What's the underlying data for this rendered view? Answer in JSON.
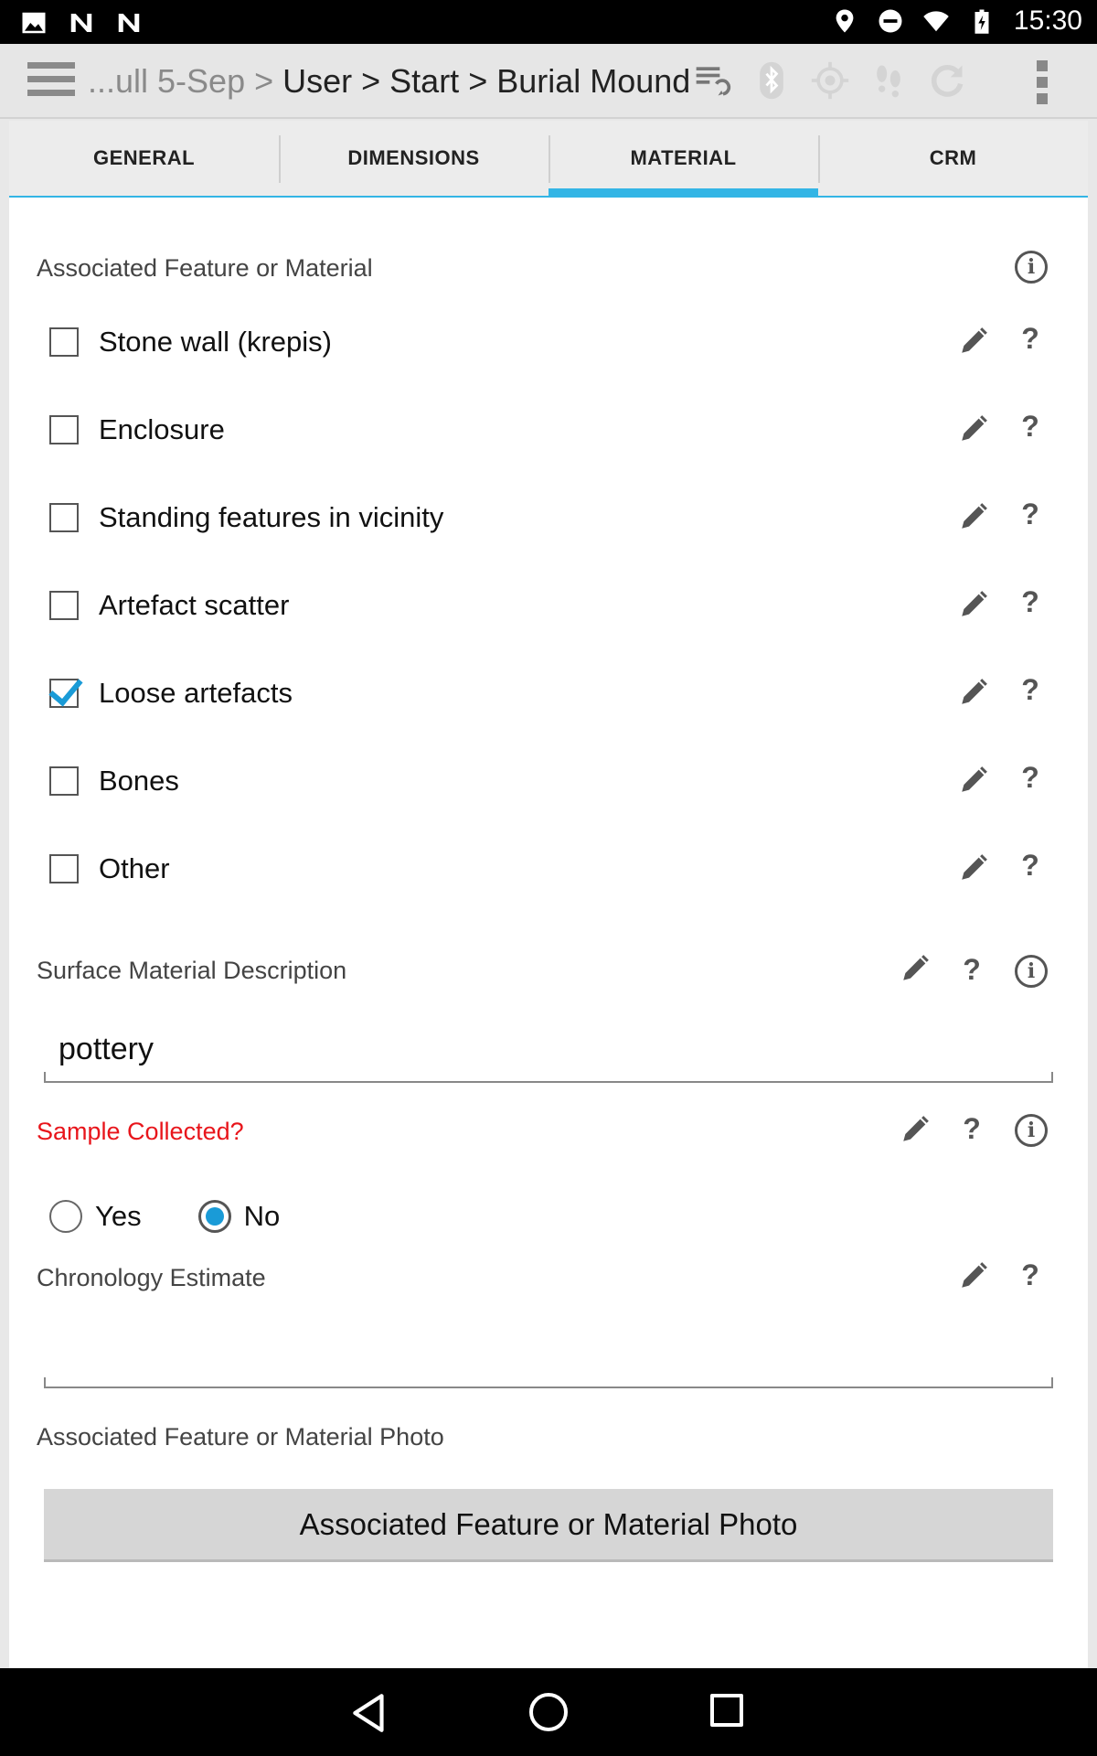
{
  "status_bar": {
    "time": "15:30",
    "left_icons": [
      "image-icon",
      "n-app-icon",
      "n-app-icon"
    ],
    "right_icons": [
      "location-icon",
      "do-not-disturb-icon",
      "wifi-icon",
      "battery-charging-icon"
    ]
  },
  "action_bar": {
    "breadcrumb_dim": "...ull 5-Sep > ",
    "breadcrumb_main": "User > Start > Burial Mound",
    "icons": [
      "sync-list-icon",
      "bluetooth-icon",
      "gps-icon",
      "footprints-icon",
      "refresh-icon"
    ]
  },
  "tabs": [
    {
      "label": "GENERAL",
      "active": false
    },
    {
      "label": "DIMENSIONS",
      "active": false
    },
    {
      "label": "MATERIAL",
      "active": true
    },
    {
      "label": "CRM",
      "active": false
    }
  ],
  "associated": {
    "label": "Associated Feature or Material",
    "items": [
      {
        "label": "Stone wall (krepis)",
        "checked": false
      },
      {
        "label": "Enclosure",
        "checked": false
      },
      {
        "label": "Standing features in vicinity",
        "checked": false
      },
      {
        "label": "Artefact scatter",
        "checked": false
      },
      {
        "label": "Loose artefacts",
        "checked": true
      },
      {
        "label": "Bones",
        "checked": false
      },
      {
        "label": "Other",
        "checked": false
      }
    ]
  },
  "surface": {
    "label": "Surface Material Description",
    "value": "pottery"
  },
  "sample": {
    "label": "Sample Collected?",
    "required_color": "#e8151b",
    "options": [
      {
        "label": "Yes",
        "selected": false
      },
      {
        "label": "No",
        "selected": true
      }
    ]
  },
  "chronology": {
    "label": "Chronology Estimate",
    "value": ""
  },
  "photo": {
    "label": "Associated Feature or Material Photo",
    "button_label": "Associated Feature or Material Photo"
  },
  "help_glyph": "?",
  "info_glyph": "i",
  "colors": {
    "accent": "#33b5e5",
    "check": "#1a9bd7"
  }
}
